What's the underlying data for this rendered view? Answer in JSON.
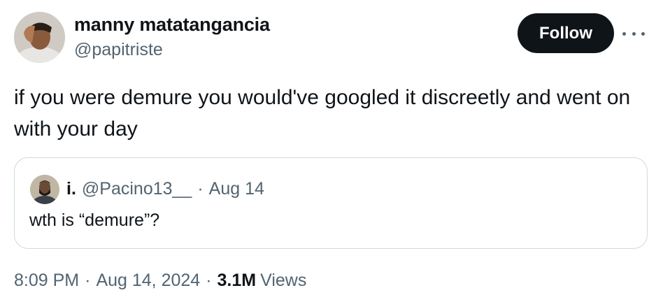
{
  "author": {
    "display_name": "manny matatangancia",
    "handle": "@papitriste"
  },
  "follow_label": "Follow",
  "tweet": {
    "text": "if you were demure you would've googled it discreetly and went on with your day"
  },
  "quoted": {
    "name": "i.",
    "handle": "@Pacino13__",
    "separator": "·",
    "date": "Aug 14",
    "text": "wth is “demure”?"
  },
  "meta": {
    "time": "8:09 PM",
    "separator": "·",
    "date": "Aug 14, 2024",
    "views_count": "3.1M",
    "views_label": "Views"
  },
  "colors": {
    "text_primary": "#0f1419",
    "text_secondary": "#536471",
    "border": "#cfd9de",
    "button_bg": "#0f1419"
  }
}
